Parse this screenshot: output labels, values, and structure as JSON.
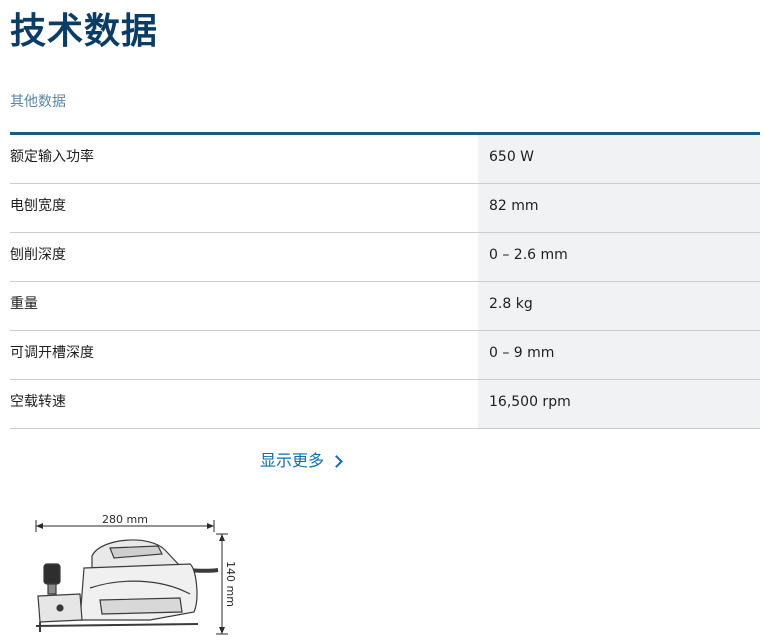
{
  "header": {
    "title": "技术数据",
    "subtitle": "其他数据"
  },
  "specs": [
    {
      "label": "额定输入功率",
      "value": "650 W"
    },
    {
      "label": "电刨宽度",
      "value": "82 mm"
    },
    {
      "label": "刨削深度",
      "value": "0 – 2.6 mm"
    },
    {
      "label": "重量",
      "value": "2.8 kg"
    },
    {
      "label": "可调开槽深度",
      "value": "0 – 9 mm"
    },
    {
      "label": "空载转速",
      "value": "16,500 rpm"
    }
  ],
  "show_more": {
    "label": "显示更多",
    "icon": "chevron-right-icon"
  },
  "diagram": {
    "width_label": "280 mm",
    "height_label": "140 mm"
  },
  "colors": {
    "title": "#0b3d64",
    "accent_rule": "#1a5a85",
    "link": "#0b6fab",
    "value_bg": "#f1f2f3"
  }
}
